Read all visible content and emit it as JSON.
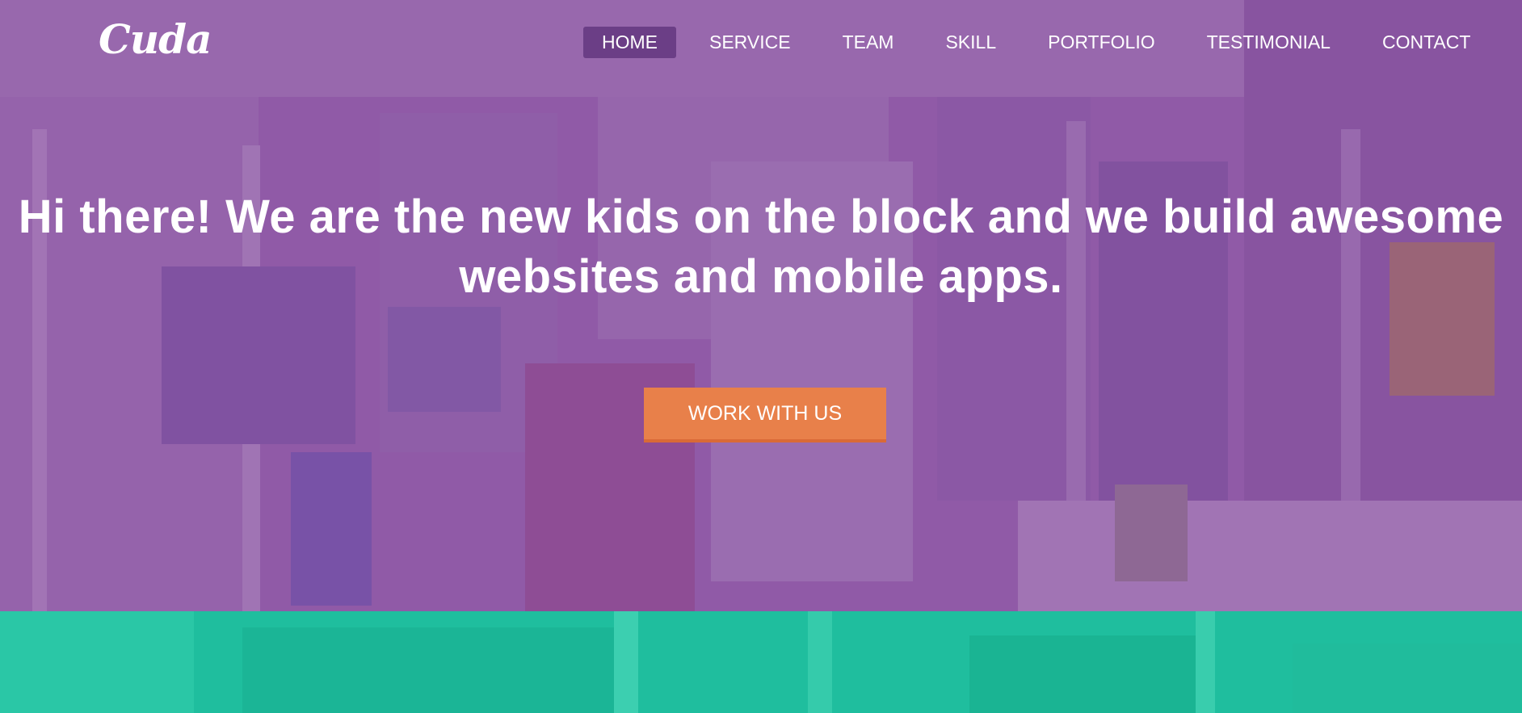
{
  "brand": {
    "logo_text": "Cuda"
  },
  "nav": {
    "items": [
      {
        "label": "HOME",
        "active": true
      },
      {
        "label": "SERVICE",
        "active": false
      },
      {
        "label": "TEAM",
        "active": false
      },
      {
        "label": "SKILL",
        "active": false
      },
      {
        "label": "PORTFOLIO",
        "active": false
      },
      {
        "label": "TESTIMONIAL",
        "active": false
      },
      {
        "label": "CONTACT",
        "active": false
      }
    ]
  },
  "hero": {
    "headline_line1": "Hi there! We are the new kids on the block and we build awesome",
    "headline_line2": "websites and mobile apps.",
    "cta_label": "WORK WITH US"
  },
  "colors": {
    "hero_overlay": "#925aa8",
    "nav_active_bg": "#6b3e86",
    "cta_bg": "#e8804a",
    "cta_border": "#d96a37",
    "section_teal": "#1fbe9e",
    "text": "#ffffff"
  }
}
